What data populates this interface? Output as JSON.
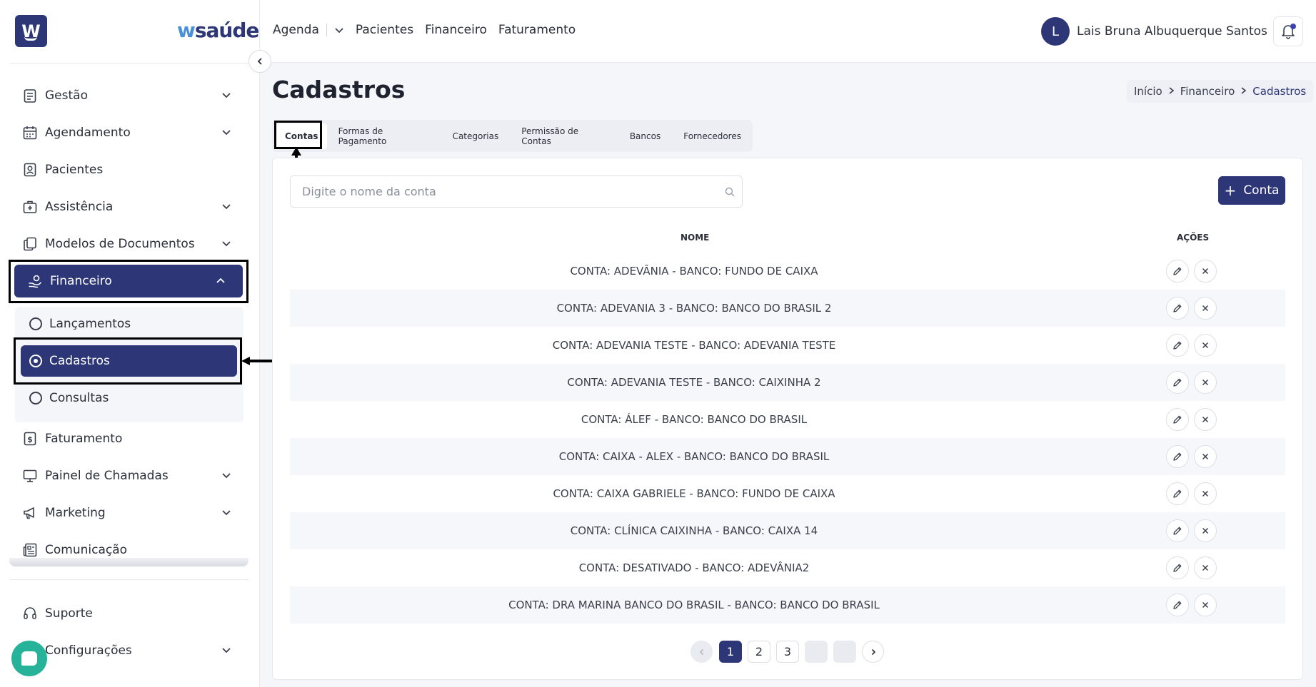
{
  "brand": {
    "logo_letter": "W",
    "name_prefix": "w",
    "name_rest": "saúde"
  },
  "sidebar": {
    "items": [
      {
        "label": "Gestão",
        "icon": "clipboard-icon"
      },
      {
        "label": "Agendamento",
        "icon": "calendar-icon"
      },
      {
        "label": "Pacientes",
        "icon": "patient-badge-icon"
      },
      {
        "label": "Assistência",
        "icon": "medical-bag-icon"
      },
      {
        "label": "Modelos de Documentos",
        "icon": "documents-icon"
      },
      {
        "label": "Financeiro",
        "icon": "hand-money-icon"
      },
      {
        "label": "Faturamento",
        "icon": "invoice-dollar-icon"
      },
      {
        "label": "Painel de Chamadas",
        "icon": "monitor-icon"
      },
      {
        "label": "Marketing",
        "icon": "megaphone-icon"
      },
      {
        "label": "Comunicação",
        "icon": "newspaper-icon"
      },
      {
        "label": "Suporte",
        "icon": "headset-icon"
      },
      {
        "label": "Configurações",
        "icon": "gear-icon"
      }
    ],
    "financeiro_sub": [
      {
        "label": "Lançamentos"
      },
      {
        "label": "Cadastros"
      },
      {
        "label": "Consultas"
      }
    ]
  },
  "topbar": {
    "nav": [
      "Agenda",
      "Pacientes",
      "Financeiro",
      "Faturamento"
    ],
    "user_initial": "L",
    "user_name": "Lais Bruna Albuquerque Santos"
  },
  "page": {
    "title": "Cadastros",
    "breadcrumb": [
      "Início",
      "Financeiro",
      "Cadastros"
    ],
    "tabs": [
      "Contas",
      "Formas de Pagamento",
      "Categorias",
      "Permissão de Contas",
      "Bancos",
      "Fornecedores"
    ],
    "search_placeholder": "Digite o nome da conta",
    "add_button": "Conta",
    "table": {
      "headers": [
        "NOME",
        "AÇÕES"
      ],
      "rows": [
        "CONTA: ADEVÂNIA - BANCO: FUNDO DE CAIXA",
        "CONTA: ADEVANIA 3 - BANCO: BANCO DO BRASIL 2",
        "CONTA: ADEVANIA TESTE - BANCO: ADEVANIA TESTE",
        "CONTA: ADEVANIA TESTE - BANCO: CAIXINHA 2",
        "CONTA: ÁLEF - BANCO: BANCO DO BRASIL",
        "CONTA: CAIXA - ALEX - BANCO: BANCO DO BRASIL",
        "CONTA: CAIXA GABRIELE - BANCO: FUNDO DE CAIXA",
        "CONTA: CLÍNICA CAIXINHA - BANCO: CAIXA 14",
        "CONTA: DESATIVADO - BANCO: ADEVÂNIA2",
        "CONTA: DRA MARINA BANCO DO BRASIL - BANCO: BANCO DO BRASIL"
      ]
    },
    "pagination": {
      "pages": [
        "1",
        "2",
        "3"
      ],
      "current": "1"
    }
  },
  "colors": {
    "primary": "#2d3778",
    "accent": "#26b39a"
  }
}
